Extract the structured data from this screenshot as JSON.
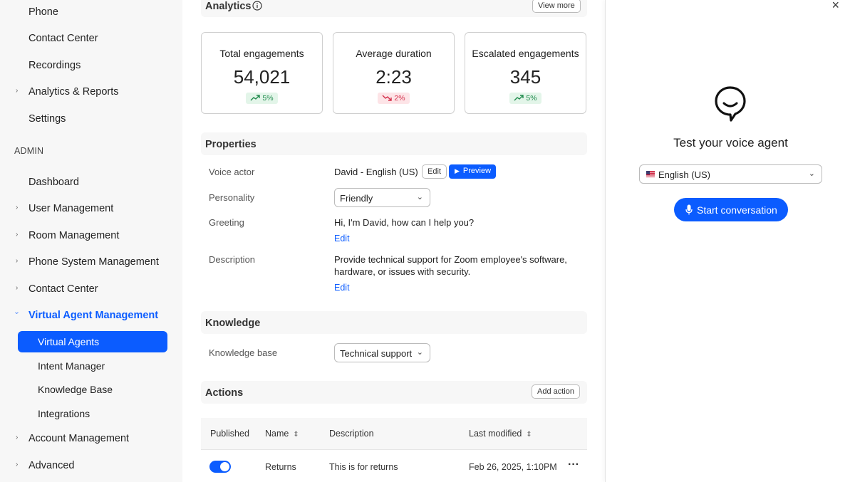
{
  "sidebar": {
    "items_top": [
      "Phone",
      "Contact Center",
      "Recordings",
      "Analytics & Reports",
      "Settings"
    ],
    "section": "ADMIN",
    "items_admin": [
      "Dashboard",
      "User Management",
      "Room Management",
      "Phone System Management",
      "Contact Center"
    ],
    "active_group": "Virtual Agent Management",
    "sub_items": [
      "Virtual Agents",
      "Intent Manager",
      "Knowledge Base",
      "Integrations"
    ],
    "items_bottom": [
      "Account Management",
      "Advanced"
    ]
  },
  "analytics": {
    "title": "Analytics",
    "view_more": "View more",
    "cards": [
      {
        "title": "Total engagements",
        "value": "54,021",
        "delta": "5%",
        "trend": "up"
      },
      {
        "title": "Average duration",
        "value": "2:23",
        "delta": "2%",
        "trend": "down"
      },
      {
        "title": "Escalated engagements",
        "value": "345",
        "delta": "5%",
        "trend": "up"
      }
    ]
  },
  "properties": {
    "title": "Properties",
    "voice_actor_label": "Voice actor",
    "voice_actor_value": "David - English (US)",
    "edit_button": "Edit",
    "preview_button": "Preview",
    "personality_label": "Personality",
    "personality_value": "Friendly",
    "greeting_label": "Greeting",
    "greeting_value": "Hi, I'm David, how can I help you?",
    "greeting_edit": "Edit",
    "description_label": "Description",
    "description_line1": "Provide technical support for Zoom employee's software,",
    "description_line2": "hardware, or issues with security.",
    "description_edit": "Edit"
  },
  "knowledge": {
    "title": "Knowledge",
    "base_label": "Knowledge base",
    "base_value": "Technical support"
  },
  "actions": {
    "title": "Actions",
    "add_action": "Add action",
    "columns": [
      "Published",
      "Name",
      "Description",
      "Last modified"
    ],
    "rows": [
      {
        "published": true,
        "name": "Returns",
        "description": "This is for returns",
        "modified": "Feb 26, 2025, 1:10PM"
      }
    ]
  },
  "panel": {
    "close": "×",
    "title": "Test your voice agent",
    "language": "English (US)",
    "start_button": "Start conversation"
  },
  "colors": {
    "accent": "#0b5cff",
    "up": "#1f8a4c",
    "down": "#d32f4a"
  }
}
